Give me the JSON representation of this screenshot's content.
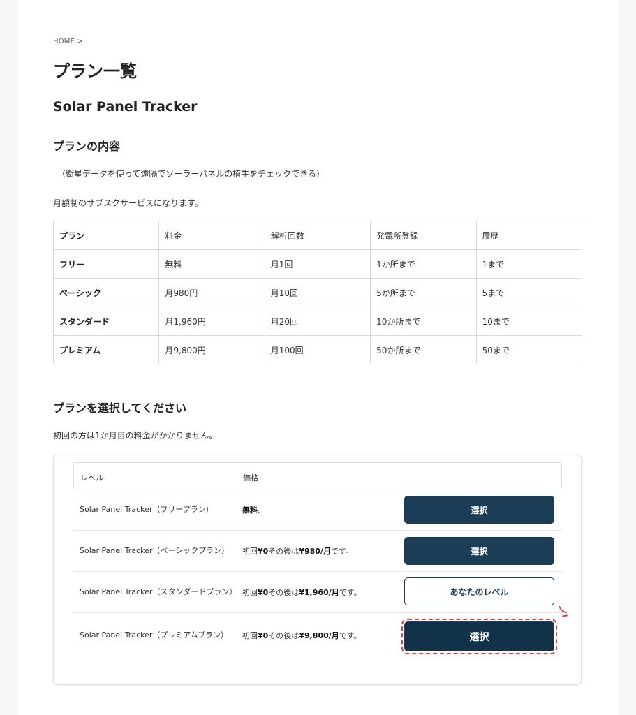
{
  "breadcrumb": "HOME >",
  "page_title": "プラン一覧",
  "product_title": "Solar Panel Tracker",
  "content_section": {
    "title": "プランの内容",
    "description": "（衛星データを使って遠隔でソーラーパネルの植生をチェックできる）",
    "subscription_note": "月額制のサブスクサービスになります。"
  },
  "spec_table": {
    "headers": [
      "プラン",
      "料金",
      "解析回数",
      "発電所登録",
      "履歴"
    ],
    "rows": [
      [
        "フリー",
        "無料",
        "月1回",
        "1か所まで",
        "1まで"
      ],
      [
        "ベーシック",
        "月980円",
        "月10回",
        "5か所まで",
        "5まで"
      ],
      [
        "スタンダード",
        "月1,960円",
        "月20回",
        "10か所まで",
        "10まで"
      ],
      [
        "プレミアム",
        "月9,800円",
        "月100回",
        "50か所まで",
        "50まで"
      ]
    ]
  },
  "select_section": {
    "title": "プランを選択してください",
    "note": "初回の方は1か月目の料金がかかりません。"
  },
  "plan_list": {
    "header_level": "レベル",
    "header_price": "価格",
    "rows": [
      {
        "name": "Solar Panel Tracker（フリープラン）",
        "price_free": "無料",
        "price_suffix": ".",
        "button": "選択"
      },
      {
        "name": "Solar Panel Tracker（ベーシックプラン）",
        "price_prefix": "初回",
        "price_first": "¥0",
        "price_mid": " その後は",
        "price_after": "¥980/月",
        "price_end": "です。",
        "button": "選択"
      },
      {
        "name": "Solar Panel Tracker（スタンダードプラン）",
        "price_prefix": "初回",
        "price_first": "¥0",
        "price_mid": " その後は",
        "price_after": "¥1,960/月",
        "price_end": "です。",
        "button": "あなたのレベル"
      },
      {
        "name": "Solar Panel Tracker（プレミアムプラン）",
        "price_prefix": "初回",
        "price_first": "¥0",
        "price_mid": " その後は",
        "price_after": "¥9,800/月",
        "price_end": "です。",
        "button": "選択"
      }
    ]
  },
  "colors": {
    "button_dark": "#1b3d55",
    "highlight": "#e23b3b"
  }
}
